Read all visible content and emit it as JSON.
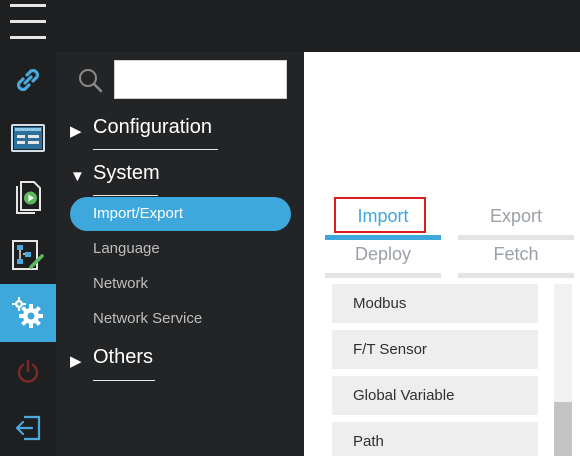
{
  "search": {
    "placeholder": "",
    "value": ""
  },
  "nav": {
    "sections": [
      {
        "label": "Configuration",
        "arrow": "▶",
        "expanded": false
      },
      {
        "label": "System",
        "arrow": "▼",
        "expanded": true
      },
      {
        "label": "Others",
        "arrow": "▶",
        "expanded": false
      }
    ],
    "system_items": [
      {
        "label": "Import/Export",
        "selected": true
      },
      {
        "label": "Language",
        "selected": false
      },
      {
        "label": "Network",
        "selected": false
      },
      {
        "label": "Network Service",
        "selected": false
      }
    ]
  },
  "rail": {
    "items": [
      {
        "icon": "link-icon",
        "active": false
      },
      {
        "icon": "dashboard-icon",
        "active": false
      },
      {
        "icon": "file-play-icon",
        "active": false
      },
      {
        "icon": "flow-edit-icon",
        "active": false
      },
      {
        "icon": "gear-icon",
        "active": true
      },
      {
        "icon": "power-icon",
        "active": false
      },
      {
        "icon": "logout-icon",
        "active": false
      }
    ]
  },
  "tabs": [
    {
      "label": "Import",
      "active": true
    },
    {
      "label": "Export",
      "active": false
    },
    {
      "label": "Deploy",
      "active": false
    },
    {
      "label": "Fetch",
      "active": false
    }
  ],
  "items": [
    "Modbus",
    "F/T Sensor",
    "Global Variable",
    "Path"
  ],
  "colors": {
    "accent": "#3ea8dd",
    "dark_bg": "#1e1f21",
    "panel_bg": "#232426",
    "highlight": "#e01b1b"
  }
}
